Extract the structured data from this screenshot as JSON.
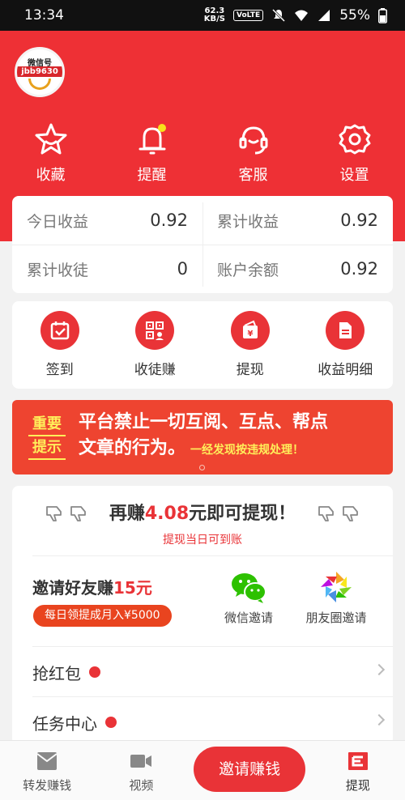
{
  "status": {
    "time": "13:34",
    "net_speed_value": "62.3",
    "net_speed_unit": "KB/S",
    "volte": "VoLTE",
    "battery": "55%"
  },
  "profile": {
    "avatar_line1": "微信号",
    "avatar_line2": "jbb9630"
  },
  "top_nav": [
    {
      "label": "收藏",
      "icon": "star-icon"
    },
    {
      "label": "提醒",
      "icon": "bell-icon"
    },
    {
      "label": "客服",
      "icon": "headset-icon"
    },
    {
      "label": "设置",
      "icon": "gear-icon"
    }
  ],
  "stats": {
    "today_label": "今日收益",
    "today_value": "0.92",
    "total_label": "累计收益",
    "total_value": "0.92",
    "apprentice_label": "累计收徒",
    "apprentice_value": "0",
    "balance_label": "账户余额",
    "balance_value": "0.92"
  },
  "quick_actions": [
    {
      "label": "签到",
      "icon": "calendar-check-icon"
    },
    {
      "label": "收徒赚",
      "icon": "qr-code-icon"
    },
    {
      "label": "提现",
      "icon": "wallet-icon"
    },
    {
      "label": "收益明细",
      "icon": "document-icon"
    }
  ],
  "notice": {
    "tag_line1": "重要",
    "tag_line2": "提示",
    "text_line1": "平台禁止一切互阅、互点、帮点",
    "text_line2": "文章的行为。",
    "text_small": "一经发现按违规处理！"
  },
  "earn": {
    "prefix": "再赚",
    "amount": "4.08",
    "suffix": "元即可提现！",
    "sub": "提现当日可到账"
  },
  "invite": {
    "title_prefix": "邀请好友赚",
    "title_amount": "15元",
    "badge": "每日领提成月入¥5000",
    "wechat_label": "微信邀请",
    "moments_label": "朋友圈邀请"
  },
  "rows": {
    "red_packet": "抢红包",
    "task_center": "任务中心"
  },
  "bottom_nav": {
    "share_earn": "转发赚钱",
    "video": "视频",
    "invite_earn": "邀请赚钱",
    "withdraw": "提现"
  },
  "colors": {
    "brand_red": "#ee3035",
    "notice_orange": "#ee4430",
    "wechat_green": "#2dc100"
  }
}
